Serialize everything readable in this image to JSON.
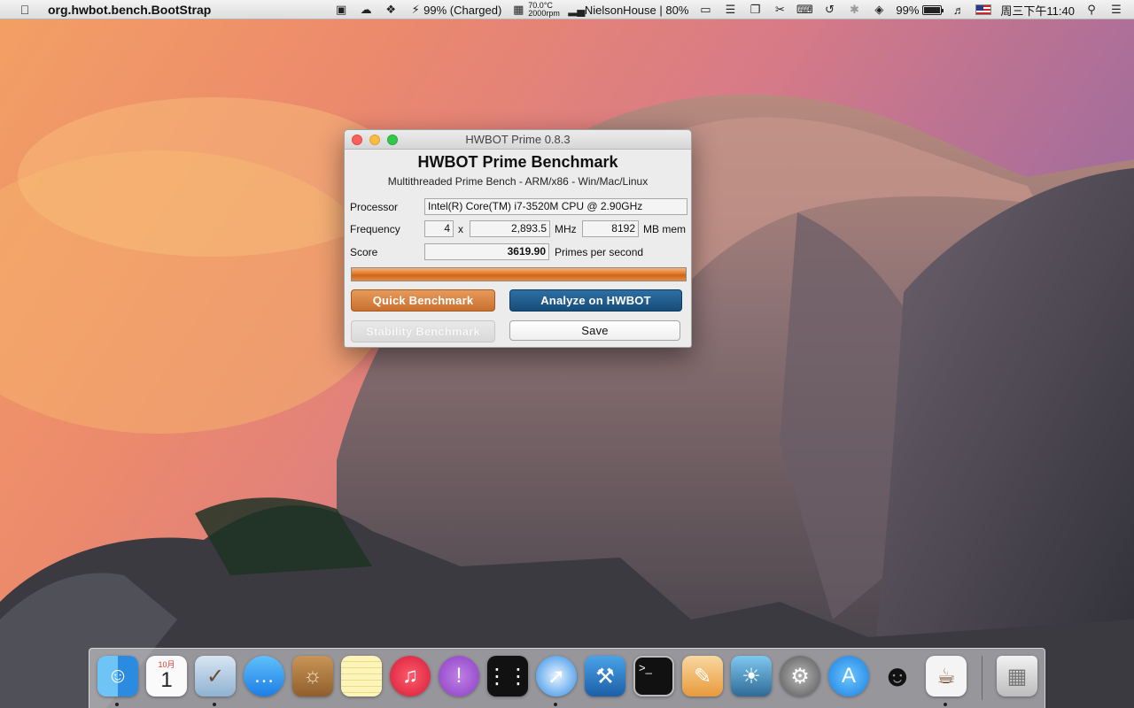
{
  "menubar": {
    "app_name": "org.hwbot.bench.BootStrap",
    "battery_status": "99% (Charged)",
    "temperature": "70.0°C",
    "fan_speed": "2000rpm",
    "network_name": "NielsonHouse | 80%",
    "battery_percent": "99%",
    "battery_level": 0.99,
    "clock": "周三下午11:40"
  },
  "window": {
    "title": "HWBOT Prime 0.8.3",
    "heading": "HWBOT Prime Benchmark",
    "subtitle": "Multithreaded Prime Bench - ARM/x86 - Win/Mac/Linux",
    "processor_label": "Processor",
    "processor_value": "Intel(R) Core(TM) i7-3520M CPU @ 2.90GHz",
    "frequency_label": "Frequency",
    "cores": "4",
    "times": "x",
    "frequency_value": "2,893.5",
    "mhz_unit": "MHz",
    "memory_value": "8192",
    "memory_unit": "MB mem",
    "score_label": "Score",
    "score_value": "3619.90",
    "score_unit": "Primes per second",
    "progress": 1.0,
    "quick_button": "Quick Benchmark",
    "analyze_button": "Analyze on HWBOT",
    "stability_button": "Stability Benchmark",
    "save_button": "Save"
  },
  "dock": {
    "calendar_month": "10月",
    "calendar_day": "1",
    "items": [
      "finder-icon",
      "calendar-icon",
      "mail-icon",
      "messages-icon",
      "contacts-icon",
      "notes-icon",
      "itunes-icon",
      "feedback-icon",
      "blackberry-icon",
      "safari-icon",
      "xcode-icon",
      "terminal-icon",
      "pages-icon",
      "iphoto-icon",
      "system-preferences-icon",
      "app-store-icon",
      "qq-icon",
      "java-icon",
      "trash-icon"
    ]
  }
}
